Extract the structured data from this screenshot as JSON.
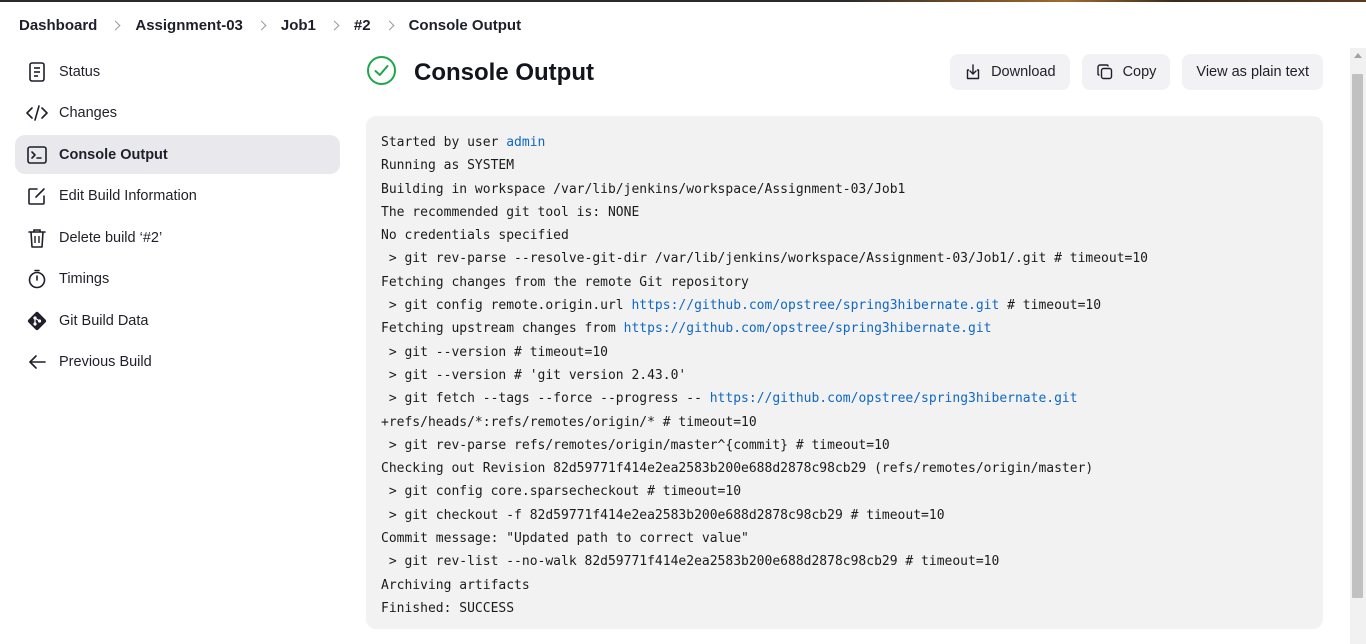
{
  "breadcrumbs": [
    "Dashboard",
    "Assignment-03",
    "Job1",
    "#2",
    "Console Output"
  ],
  "sidebar": {
    "items": [
      {
        "label": "Status",
        "icon": "document-icon"
      },
      {
        "label": "Changes",
        "icon": "code-icon"
      },
      {
        "label": "Console Output",
        "icon": "terminal-icon",
        "active": true
      },
      {
        "label": "Edit Build Information",
        "icon": "edit-icon"
      },
      {
        "label": "Delete build ‘#2’",
        "icon": "trash-icon"
      },
      {
        "label": "Timings",
        "icon": "stopwatch-icon"
      },
      {
        "label": "Git Build Data",
        "icon": "git-icon"
      },
      {
        "label": "Previous Build",
        "icon": "arrow-left-icon"
      }
    ]
  },
  "page": {
    "title": "Console Output",
    "status": "success",
    "status_color": "#1ea64b"
  },
  "actions": {
    "download": "Download",
    "copy": "Copy",
    "plain_text": "View as plain text"
  },
  "console": {
    "lines": [
      [
        {
          "t": "Started by user "
        },
        {
          "t": "admin",
          "link": true
        }
      ],
      [
        {
          "t": "Running as SYSTEM"
        }
      ],
      [
        {
          "t": "Building in workspace /var/lib/jenkins/workspace/Assignment-03/Job1"
        }
      ],
      [
        {
          "t": "The recommended git tool is: NONE"
        }
      ],
      [
        {
          "t": "No credentials specified"
        }
      ],
      [
        {
          "t": " > git rev-parse --resolve-git-dir /var/lib/jenkins/workspace/Assignment-03/Job1/.git # timeout=10"
        }
      ],
      [
        {
          "t": "Fetching changes from the remote Git repository"
        }
      ],
      [
        {
          "t": " > git config remote.origin.url "
        },
        {
          "t": "https://github.com/opstree/spring3hibernate.git",
          "link": true
        },
        {
          "t": " # timeout=10"
        }
      ],
      [
        {
          "t": "Fetching upstream changes from "
        },
        {
          "t": "https://github.com/opstree/spring3hibernate.git",
          "link": true
        }
      ],
      [
        {
          "t": " > git --version # timeout=10"
        }
      ],
      [
        {
          "t": " > git --version # 'git version 2.43.0'"
        }
      ],
      [
        {
          "t": " > git fetch --tags --force --progress -- "
        },
        {
          "t": "https://github.com/opstree/spring3hibernate.git",
          "link": true
        }
      ],
      [
        {
          "t": "+refs/heads/*:refs/remotes/origin/* # timeout=10"
        }
      ],
      [
        {
          "t": " > git rev-parse refs/remotes/origin/master^{commit} # timeout=10"
        }
      ],
      [
        {
          "t": "Checking out Revision 82d59771f414e2ea2583b200e688d2878c98cb29 (refs/remotes/origin/master)"
        }
      ],
      [
        {
          "t": " > git config core.sparsecheckout # timeout=10"
        }
      ],
      [
        {
          "t": " > git checkout -f 82d59771f414e2ea2583b200e688d2878c98cb29 # timeout=10"
        }
      ],
      [
        {
          "t": "Commit message: \"Updated path to correct value\""
        }
      ],
      [
        {
          "t": " > git rev-list --no-walk 82d59771f414e2ea2583b200e688d2878c98cb29 # timeout=10"
        }
      ],
      [
        {
          "t": "Archiving artifacts"
        }
      ],
      [
        {
          "t": "Finished: SUCCESS"
        }
      ]
    ]
  }
}
